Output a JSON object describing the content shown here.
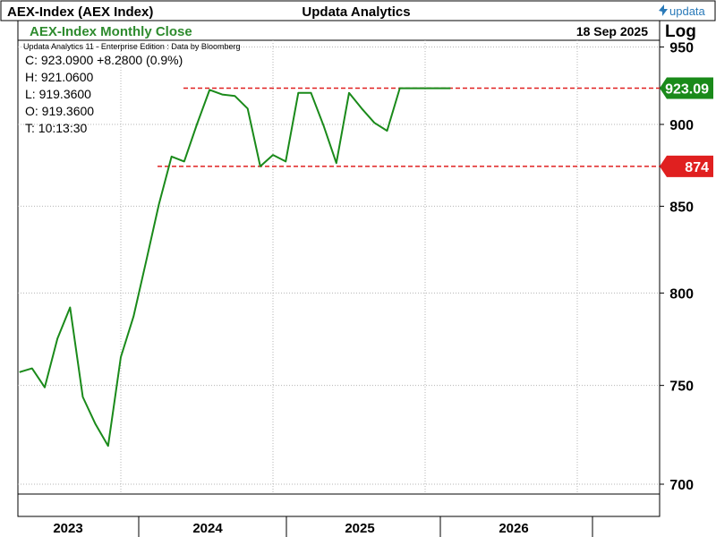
{
  "header": {
    "symbol": "AEX-Index (AEX Index)",
    "vendor": "Updata Analytics",
    "brand": "updata",
    "brand_color": "#2a7ab9"
  },
  "chart_header": {
    "series_title": "AEX-Index Monthly Close",
    "date": "18 Sep 2025",
    "scale_label": "Log",
    "edition": "Updata Analytics 11 - Enterprise Edition : Data by Bloomberg"
  },
  "quote": {
    "close": "C: 923.0900   +8.2800 (0.9%)",
    "high": "H: 921.0600",
    "low": "L: 919.3600",
    "open": "O: 919.3600",
    "time": "T: 10:13:30"
  },
  "colors": {
    "line": "#1a8a1a",
    "title": "#2e8b2e",
    "resistance": "#e02020",
    "grid": "#b4b4b4",
    "frame": "#000000"
  },
  "chart_data": {
    "type": "line",
    "scale": "log",
    "title": "AEX-Index Monthly Close",
    "ylabel": "Log",
    "ylim": [
      695,
      955
    ],
    "y_ticks": [
      700,
      750,
      800,
      850,
      900,
      950
    ],
    "x_ticks": [
      "2023",
      "2024",
      "2025",
      "2026"
    ],
    "grid": true,
    "series": [
      {
        "name": "AEX-Index Monthly Close",
        "dates": [
          "2022-11",
          "2022-12",
          "2023-01",
          "2023-02",
          "2023-03",
          "2023-04",
          "2023-05",
          "2023-06",
          "2023-07",
          "2023-08",
          "2023-09",
          "2023-10",
          "2023-11",
          "2023-12",
          "2024-01",
          "2024-02",
          "2024-03",
          "2024-04",
          "2024-05",
          "2024-06",
          "2024-07",
          "2024-08",
          "2024-09",
          "2024-10",
          "2024-11",
          "2024-12",
          "2025-01",
          "2025-02",
          "2025-03",
          "2025-04",
          "2025-05",
          "2025-06",
          "2025-07",
          "2025-08",
          "2025-09"
        ],
        "values": [
          757,
          759,
          749,
          775,
          792,
          744,
          730,
          719,
          765,
          787,
          818,
          851,
          880,
          877,
          900,
          922,
          919,
          918,
          910,
          874,
          881,
          877,
          920,
          920,
          899,
          876,
          920,
          910,
          901,
          896,
          923,
          923,
          923,
          923,
          923
        ]
      }
    ],
    "annotations": [
      {
        "type": "hline",
        "value": 923.09,
        "label": "923.09",
        "color": "#e02020"
      },
      {
        "type": "hline",
        "value": 874,
        "label": "874",
        "color": "#e02020"
      }
    ]
  }
}
